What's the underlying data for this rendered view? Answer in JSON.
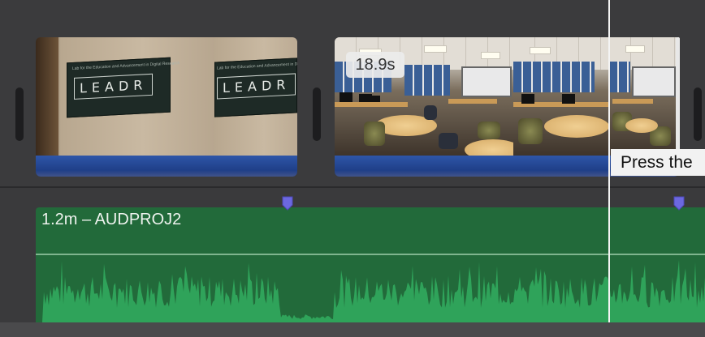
{
  "video_track": {
    "clips": [
      {
        "name": "leadr-sign-clip",
        "sign_text": "LEADR",
        "sign_subtext": "Lab for the Education and Advancement in Digital Research"
      },
      {
        "name": "classroom-clip",
        "duration_label": "18.9s"
      }
    ]
  },
  "tooltip": {
    "text": "Press the"
  },
  "audio_track": {
    "title": "1.2m – AUDPROJ2"
  },
  "colors": {
    "audio_clip": "#226a3a",
    "waveform": "#2fa35a",
    "marker": "#6c68e0",
    "video_audio_strip": "#2e56a8"
  }
}
